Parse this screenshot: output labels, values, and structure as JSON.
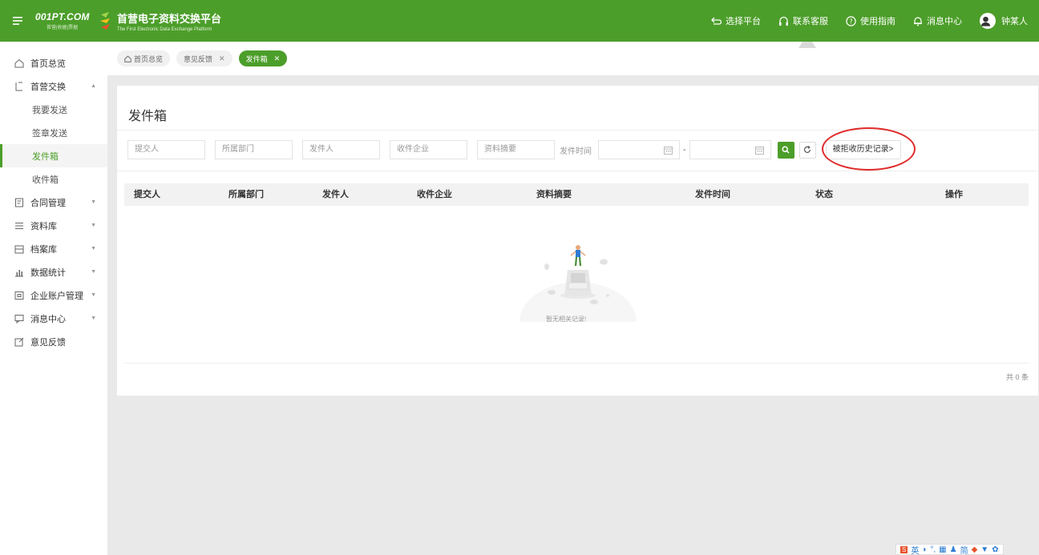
{
  "header": {
    "logo_text": "001PT.COM",
    "logo_sub": "首营|收据|票据",
    "brand_title": "首营电子资料交换平台",
    "brand_subtitle": "The First Electronic Data Exchange Platform",
    "items": [
      {
        "label": "选择平台",
        "icon": "switch-icon"
      },
      {
        "label": "联系客服",
        "icon": "headset-icon"
      },
      {
        "label": "使用指南",
        "icon": "help-icon"
      },
      {
        "label": "消息中心",
        "icon": "bell-icon"
      }
    ],
    "user_name": "钟某人",
    "color": "#4c9e2a"
  },
  "sidebar": {
    "items": [
      {
        "label": "首页总览",
        "icon": "home-icon"
      },
      {
        "label": "首营交换",
        "icon": "exchange-icon"
      },
      {
        "label": "合同管理",
        "icon": "contract-icon"
      },
      {
        "label": "资料库",
        "icon": "library-icon"
      },
      {
        "label": "档案库",
        "icon": "archive-icon"
      },
      {
        "label": "数据统计",
        "icon": "chart-icon"
      },
      {
        "label": "企业账户管理",
        "icon": "account-icon"
      },
      {
        "label": "消息中心",
        "icon": "message-icon"
      },
      {
        "label": "意见反馈",
        "icon": "feedback-icon"
      }
    ],
    "sub_items": [
      {
        "label": "我要发送"
      },
      {
        "label": "签章发送"
      },
      {
        "label": "发件箱"
      },
      {
        "label": "收件箱"
      }
    ],
    "active_sub": "发件箱"
  },
  "tabs": [
    {
      "label": "首页总览"
    },
    {
      "label": "意见反馈"
    },
    {
      "label": "发件箱"
    }
  ],
  "main": {
    "title": "发件箱",
    "filters": {
      "submitter": "提交人",
      "department": "所属部门",
      "sender": "发件人",
      "receiver": "收件企业",
      "summary": "资料摘要",
      "time_label": "发件时间",
      "date_sep": "-"
    },
    "history_button": "被拒收历史记录>",
    "columns": [
      "提交人",
      "所属部门",
      "发件人",
      "收件企业",
      "资料摘要",
      "发件时间",
      "状态",
      "操作"
    ],
    "empty_text": "暂无相关记录!",
    "total": "共 0 条"
  }
}
